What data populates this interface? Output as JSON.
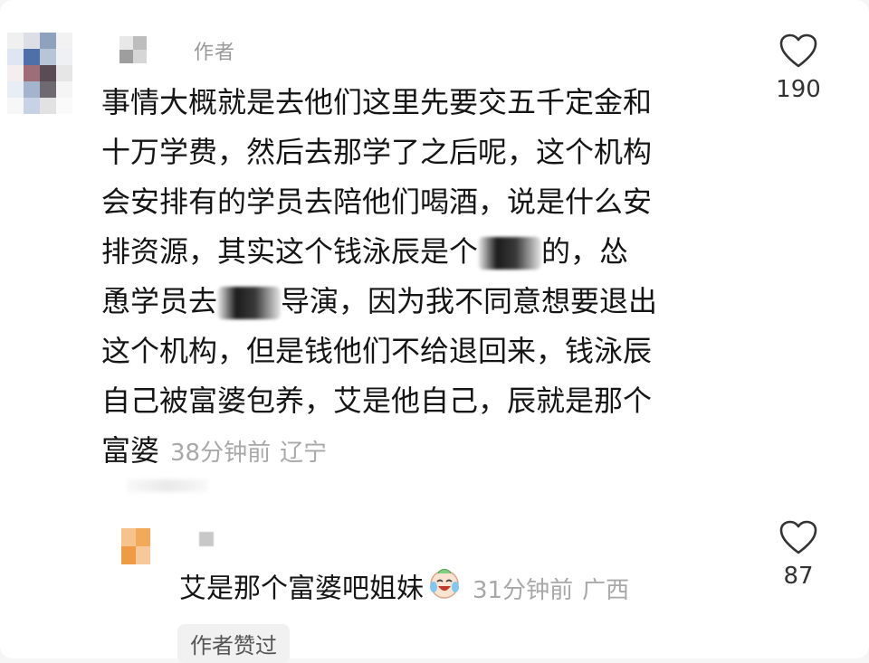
{
  "comment": {
    "author_tag": "作者",
    "lines": [
      "事情大概就是去他们这里先要交五千定金和",
      "十万学费，然后去那学了之后呢，这个机构",
      "会安排有的学员去陪他们喝酒，说是什么安",
      "排资源，其实这个钱泳辰是个",
      "的，怂",
      "恿学员去",
      "导演，因为我不同意想要退出",
      "这个机构，但是钱他们不给退回来，钱泳辰",
      "自己被富婆包养，艾是他自己，辰就是那个",
      "富婆"
    ],
    "time": "38分钟前",
    "location": "辽宁",
    "like_count": "190"
  },
  "reply": {
    "text": "艾是那个富婆吧姐妹",
    "emoji": "crying-laughing-emoji",
    "time": "31分钟前",
    "location": "广西",
    "like_count": "87",
    "author_liked_label": "作者赞过"
  },
  "colors": {
    "text": "#151515",
    "meta": "#a8a8a8",
    "author_tag": "#9a9a9a",
    "badge_bg": "#f1f1f1"
  }
}
